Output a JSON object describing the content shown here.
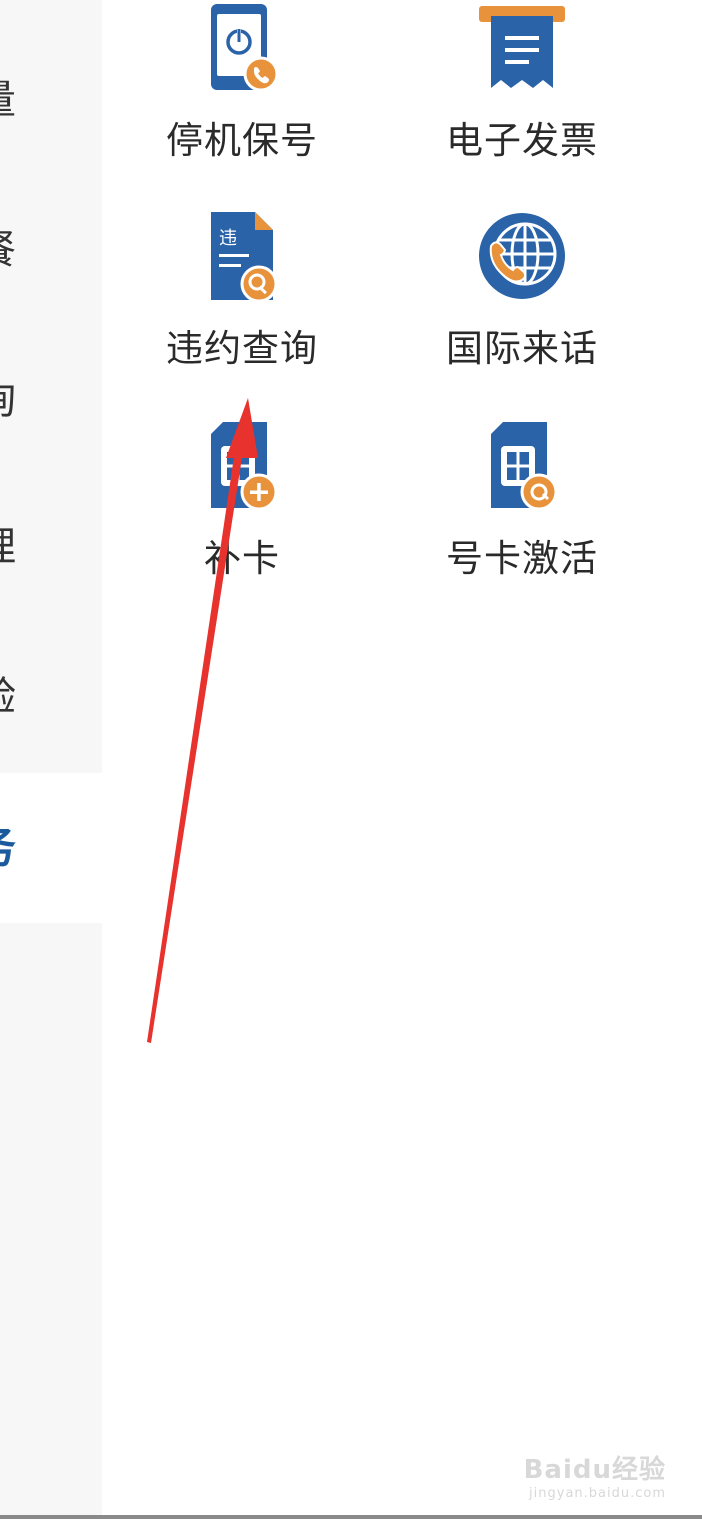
{
  "sidebar": {
    "items": [
      {
        "label": "流量",
        "active": false
      },
      {
        "label": "套餐",
        "active": false
      },
      {
        "label": "查询",
        "active": false
      },
      {
        "label": "办理",
        "active": false
      },
      {
        "label": "体验",
        "active": false
      },
      {
        "label": "服务",
        "active": true
      }
    ]
  },
  "services": [
    {
      "label": "停机保号",
      "icon": "phone-power-icon"
    },
    {
      "label": "电子发票",
      "icon": "invoice-receipt-icon"
    },
    {
      "label": "违约查询",
      "icon": "document-search-icon"
    },
    {
      "label": "国际来话",
      "icon": "globe-phone-icon"
    },
    {
      "label": "补卡",
      "icon": "sim-add-icon"
    },
    {
      "label": "号卡激活",
      "icon": "sim-activate-icon"
    }
  ],
  "colors": {
    "brand_blue": "#2a63a8",
    "accent_orange": "#e8933c",
    "active_text": "#1c5a9e",
    "arrow_red": "#e8322e"
  },
  "watermark": {
    "main": "Baidu经验",
    "sub": "jingyan.baidu.com"
  }
}
